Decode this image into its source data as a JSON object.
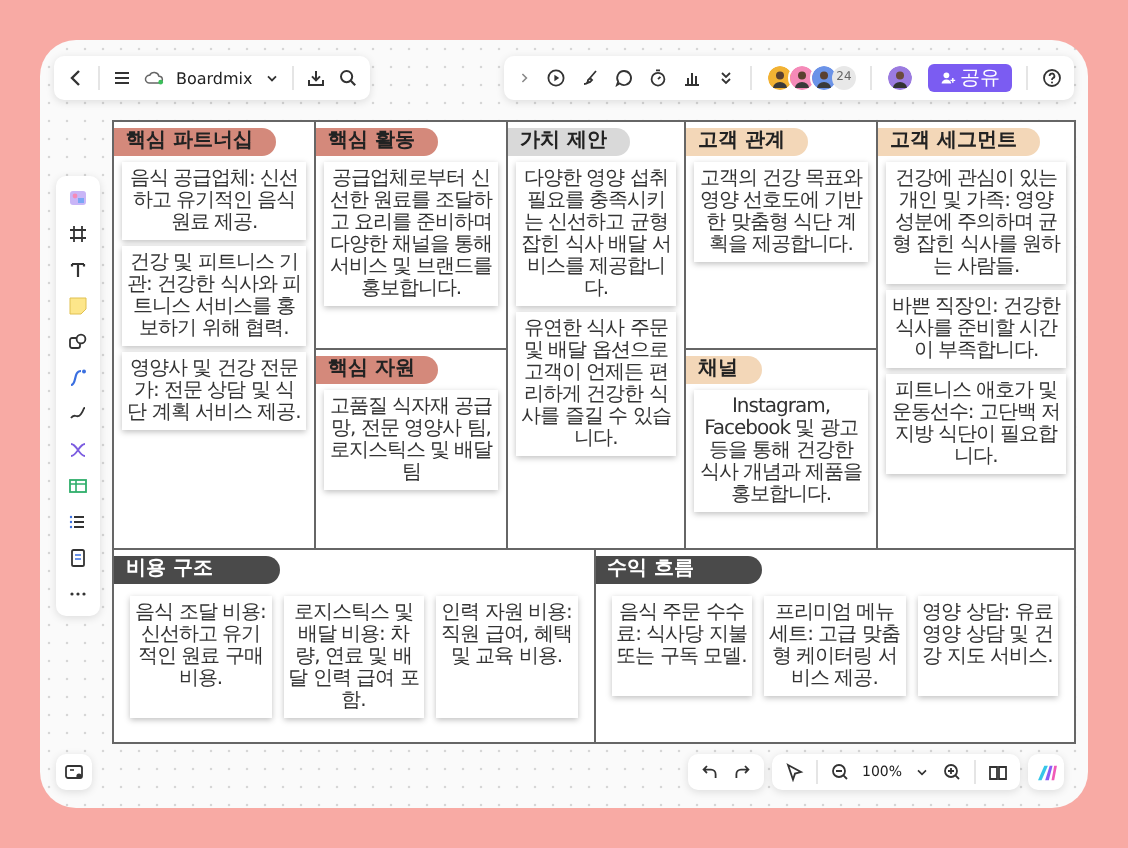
{
  "top_bar": {
    "board_name": "Boardmix",
    "collaborators": [
      {
        "color": "#f2b233"
      },
      {
        "color": "#f58ab8"
      },
      {
        "color": "#6b93e8"
      }
    ],
    "collaborator_count": "24",
    "user_avatar": {
      "color": "#9b7be0"
    },
    "share_button": "공유"
  },
  "canvas": {
    "top_columns": [
      {
        "sections": [
          {
            "title": "핵심 파트너십",
            "color": "#d4897b",
            "notes": [
              "음식 공급업체: 신선하고 유기적인 음식 원료 제공.",
              "건강 및 피트니스 기관: 건강한 식사와 피트니스 서비스를 홍보하기 위해 협력.",
              "영양사 및 건강 전문가: 전문 상담 및 식단 계획 서비스 제공."
            ]
          }
        ]
      },
      {
        "sections": [
          {
            "title": "핵심 활동",
            "color": "#d4897b",
            "notes": [
              "공급업체로부터 신선한 원료를 조달하고 요리를 준비하며 다양한 채널을 통해 서비스 및 브랜드를 홍보합니다."
            ]
          },
          {
            "title": "핵심 자원",
            "color": "#d4897b",
            "notes": [
              "고품질 식자재 공급망, 전문 영양사 팀, 로지스틱스 및 배달 팀"
            ]
          }
        ]
      },
      {
        "sections": [
          {
            "title": "가치 제안",
            "color": "#d9d9d9",
            "notes": [
              "다양한 영양 섭취 필요를 충족시키는 신선하고 균형 잡힌 식사 배달 서비스를 제공합니다.",
              "유연한 식사 주문 및 배달 옵션으로 고객이 언제든 편리하게 건강한 식사를 즐길 수 있습니다."
            ]
          }
        ]
      },
      {
        "sections": [
          {
            "title": "고객 관계",
            "color": "#f3d7b8",
            "notes": [
              "고객의 건강 목표와 영양 선호도에 기반한 맞춤형 식단 계획을 제공합니다."
            ]
          },
          {
            "title": "채널",
            "color": "#f3d7b8",
            "notes": [
              "Instagram, Facebook 및 광고 등을 통해 건강한 식사 개념과 제품을 홍보합니다."
            ]
          }
        ]
      },
      {
        "sections": [
          {
            "title": "고객 세그먼트",
            "color": "#f3d7b8",
            "notes": [
              "건강에 관심이 있는 개인 및 가족: 영양 성분에 주의하며 균형 잡힌 식사를 원하는 사람들.",
              "바쁜 직장인: 건강한 식사를 준비할 시간이 부족합니다.",
              "피트니스 애호가 및 운동선수: 고단백 저지방 식단이 필요합니다."
            ]
          }
        ]
      }
    ],
    "bottom_sections": [
      {
        "title": "비용 구조",
        "color": "#4a4a4a",
        "notes": [
          "음식 조달 비용: 신선하고 유기적인 원료 구매 비용.",
          "로지스틱스 및 배달 비용: 차량, 연료 및 배달 인력 급여 포함.",
          "인력 자원 비용: 직원 급여, 혜택 및 교육 비용."
        ]
      },
      {
        "title": "수익 흐름",
        "color": "#4a4a4a",
        "notes": [
          "음식 주문 수수료: 식사당 지불 또는 구독 모델.",
          "프리미엄 메뉴 세트: 고급 맞춤형 케이터링 서비스 제공.",
          "영양 상담: 유료 영양 상담 및 건강 지도 서비스."
        ]
      }
    ]
  },
  "bottom_bar": {
    "zoom": "100%"
  }
}
